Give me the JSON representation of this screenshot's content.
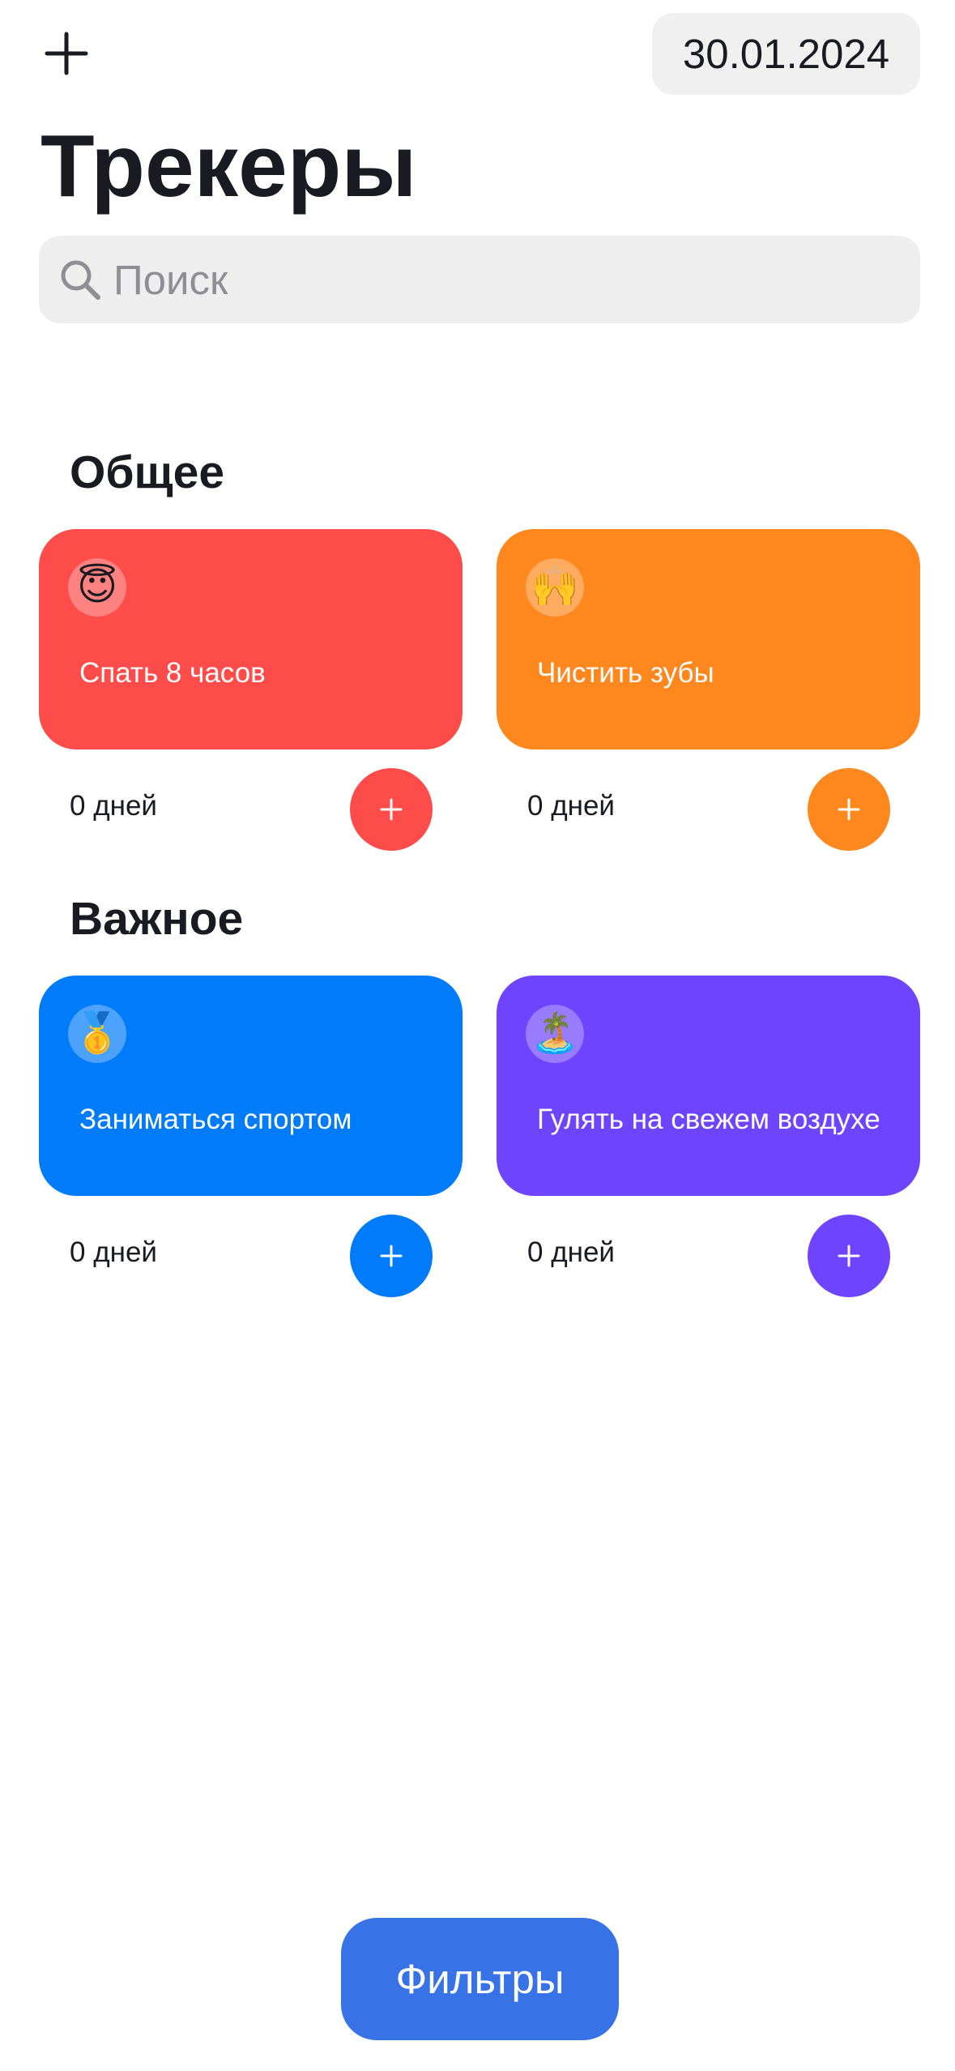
{
  "header": {
    "add_icon": "plus-icon",
    "date": "30.01.2024"
  },
  "title": "Трекеры",
  "search": {
    "placeholder": "Поиск",
    "value": "",
    "icon": "magnifier-icon"
  },
  "categories": [
    {
      "title": "Общее",
      "trackers": [
        {
          "emoji": "😇",
          "title": "Спать 8 часов",
          "days": "0 дней",
          "color": "#FD4C49"
        },
        {
          "emoji": "🙌",
          "title": "Чистить зубы",
          "days": "0 дней",
          "color": "#FF881E"
        }
      ]
    },
    {
      "title": "Важное",
      "trackers": [
        {
          "emoji": "🥇",
          "title": "Заниматься спортом",
          "days": "0 дней",
          "color": "#007BFA"
        },
        {
          "emoji": "🏝️",
          "title": "Гулять на свежем воздухе",
          "days": "0 дней",
          "color": "#6E44FE"
        }
      ]
    }
  ],
  "filters_label": "Фильтры",
  "colors": {
    "text": "#1A1B22",
    "search_bg": "#EEEEEF",
    "placeholder": "#8E8E93",
    "filters_button": "#3772E7"
  }
}
